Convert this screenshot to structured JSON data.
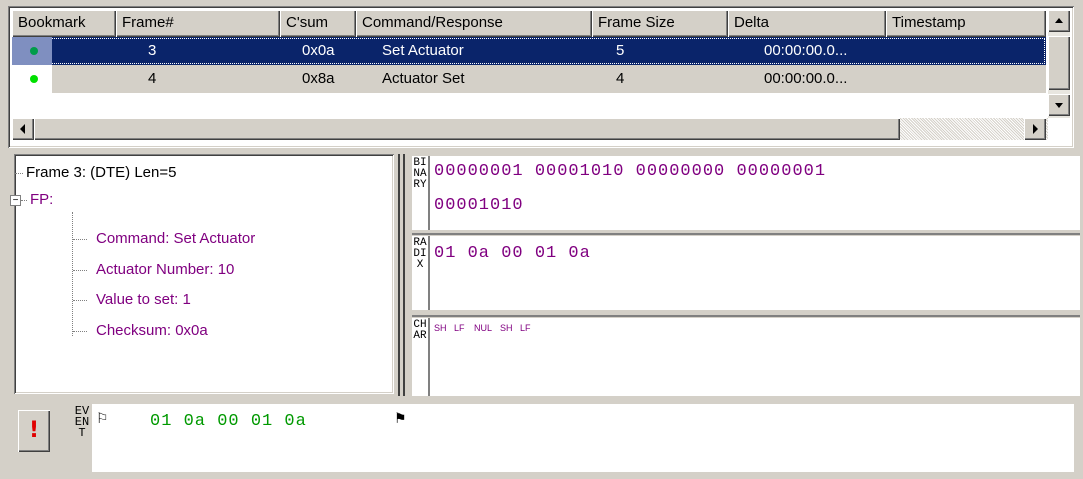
{
  "grid": {
    "columns": [
      "Bookmark",
      "Frame#",
      "C'sum",
      "Command/Response",
      "Frame Size",
      "Delta",
      "Timestamp"
    ],
    "rows": [
      {
        "frame": "3",
        "csum": "0x0a",
        "command": "Set Actuator",
        "size": "5",
        "delta": "00:00:00.0...",
        "timestamp": "",
        "selected": true
      },
      {
        "frame": "4",
        "csum": "0x8a",
        "command": "Actuator Set",
        "size": "4",
        "delta": "00:00:00.0...",
        "timestamp": "",
        "selected": false
      }
    ]
  },
  "tree": {
    "frame_line": "Frame 3: (DTE) Len=5",
    "fp_label": "FP:",
    "expander": "−",
    "children": [
      "Command: Set Actuator",
      "Actuator Number: 10",
      "Value to set: 1",
      "Checksum: 0x0a"
    ]
  },
  "panes": {
    "binary": {
      "label": "BINARY",
      "line1": "00000001 00001010 00000000 00000001",
      "line2": "00001010"
    },
    "radix": {
      "label": "RADIX",
      "line1": "01 0a 00 01 0a"
    },
    "char": {
      "label": "CHAR",
      "controls": [
        "SH",
        "LF",
        "NUL",
        "SH",
        "LF"
      ]
    }
  },
  "event": {
    "label": "EVENT",
    "hex": "01 0a 00 01 0a",
    "button_glyph": "!"
  },
  "colors": {
    "selection": "#0a246a",
    "hex_text": "#800080",
    "event_text": "#009900",
    "bookmark_dot": "#00e000"
  },
  "icons": [
    "scroll-up-icon",
    "scroll-down-icon",
    "scroll-left-icon",
    "scroll-right-icon",
    "bookmark-dot-icon",
    "flag-start-icon",
    "flag-end-icon",
    "alert-icon"
  ]
}
